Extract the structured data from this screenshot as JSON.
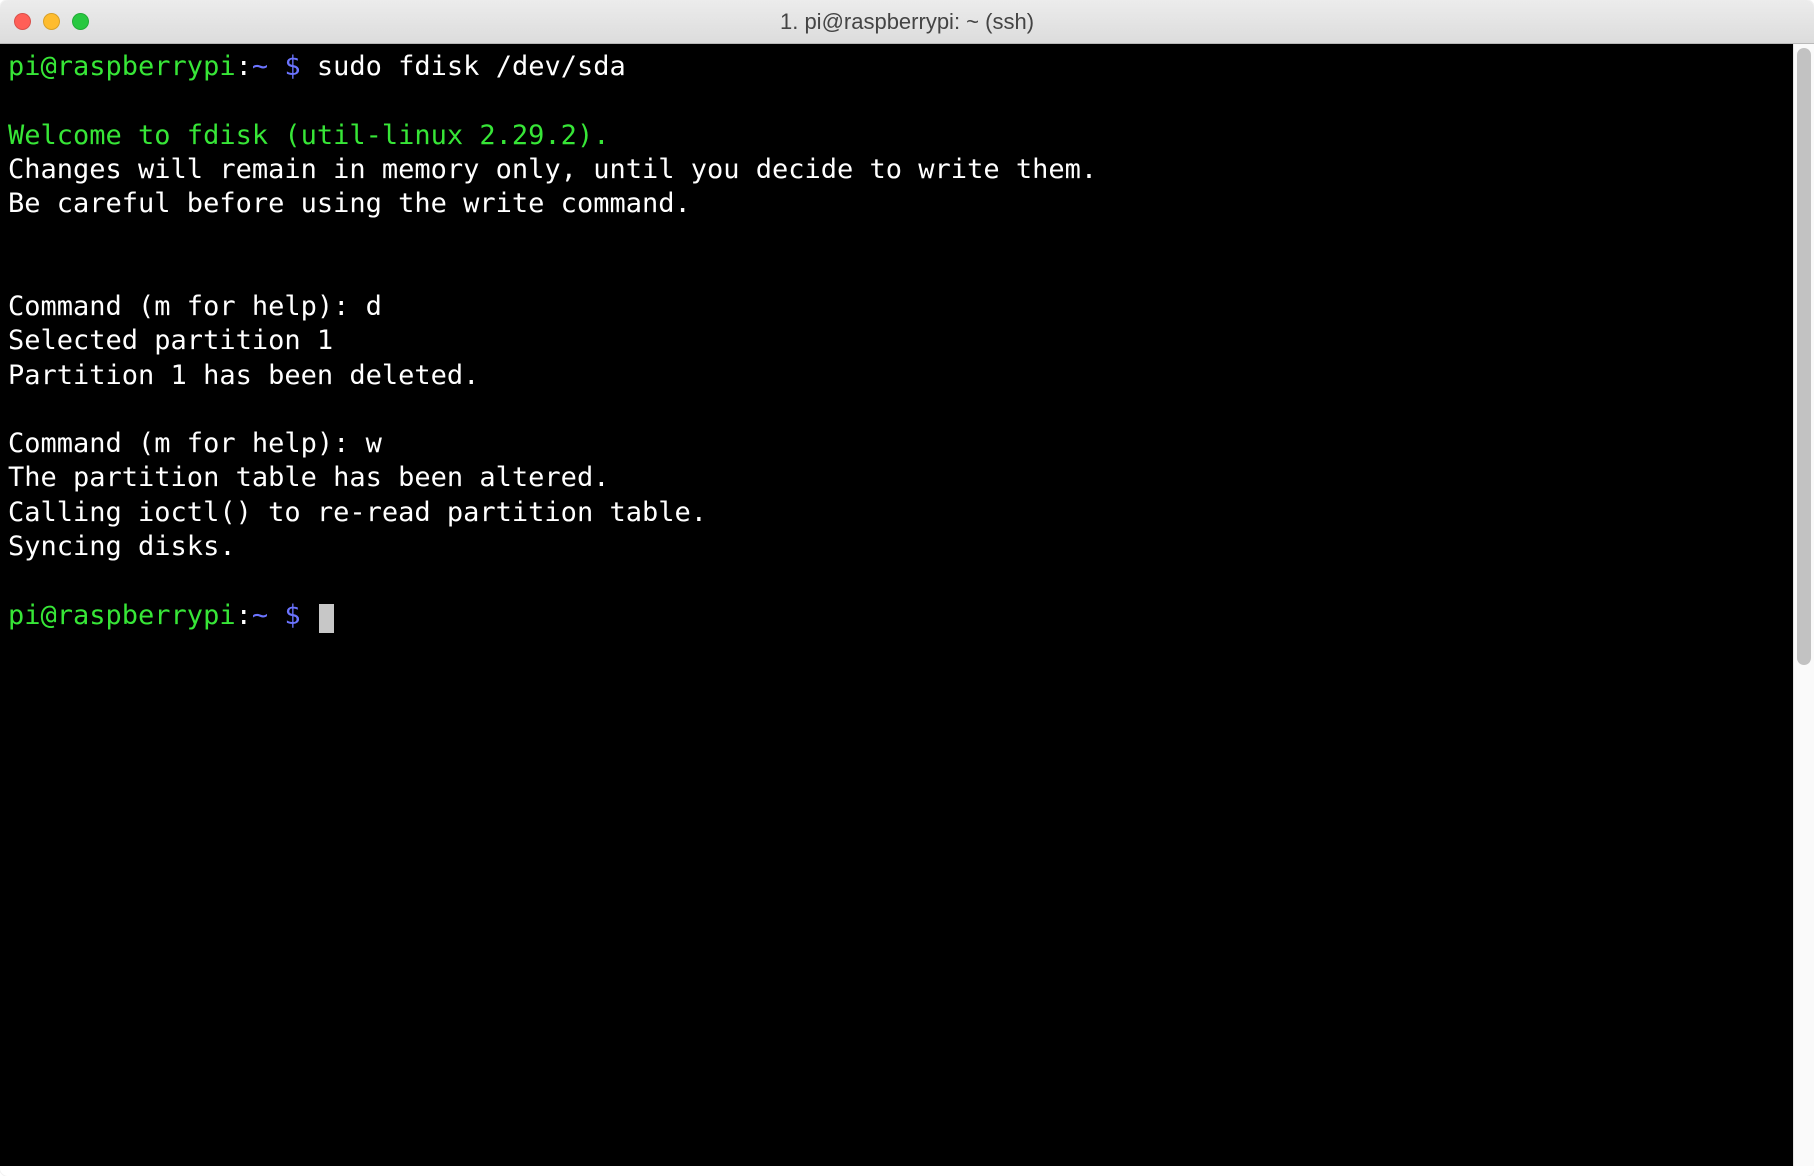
{
  "window": {
    "title": "1. pi@raspberrypi: ~ (ssh)"
  },
  "term": {
    "prompt_user_host": "pi@raspberrypi",
    "prompt_sep": ":",
    "prompt_path": "~ $",
    "cmd1": " sudo fdisk /dev/sda",
    "blank": "",
    "welcome": "Welcome to fdisk (util-linux 2.29.2).",
    "line_changes": "Changes will remain in memory only, until you decide to write them.",
    "line_careful": "Be careful before using the write command.",
    "line_cmd_d": "Command (m for help): d",
    "line_sel": "Selected partition 1",
    "line_delpart": "Partition 1 has been deleted.",
    "line_cmd_w": "Command (m for help): w",
    "line_altered": "The partition table has been altered.",
    "line_ioctl": "Calling ioctl() to re-read partition table.",
    "line_sync": "Syncing disks."
  }
}
